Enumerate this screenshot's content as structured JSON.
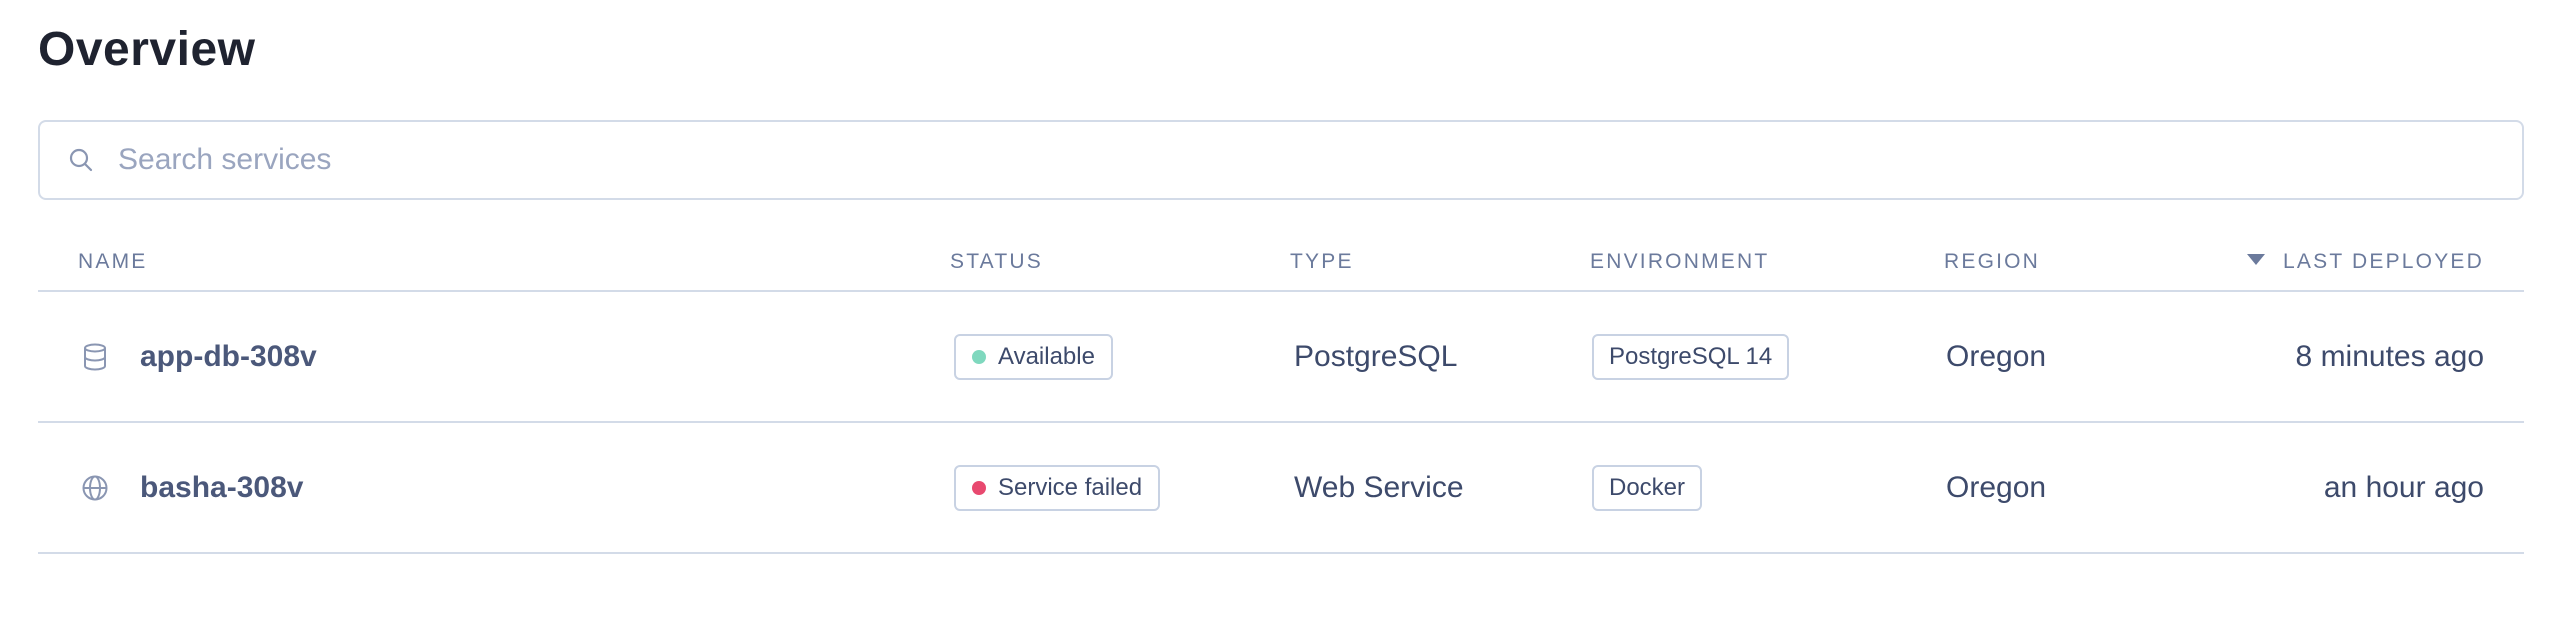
{
  "page": {
    "title": "Overview"
  },
  "search": {
    "placeholder": "Search services",
    "value": ""
  },
  "table": {
    "columns": {
      "name": "NAME",
      "status": "STATUS",
      "type": "TYPE",
      "environment": "ENVIRONMENT",
      "region": "REGION",
      "last_deployed": "LAST DEPLOYED"
    },
    "sort": {
      "column": "last_deployed",
      "direction": "descending"
    },
    "rows": [
      {
        "icon": "database-icon",
        "name": "app-db-308v",
        "status": "Available",
        "status_color": "#7fd8be",
        "type": "PostgreSQL",
        "environment": "PostgreSQL 14",
        "region": "Oregon",
        "last_deployed": "8 minutes ago"
      },
      {
        "icon": "globe-icon",
        "name": "basha-308v",
        "status": "Service failed",
        "status_color": "#e8496f",
        "type": "Web Service",
        "environment": "Docker",
        "region": "Oregon",
        "last_deployed": "an hour ago"
      }
    ]
  },
  "colors": {
    "title": "#1f2330",
    "text": "#3d4a6b",
    "header_text": "#6b7a9c",
    "border": "#d3dbe8"
  }
}
